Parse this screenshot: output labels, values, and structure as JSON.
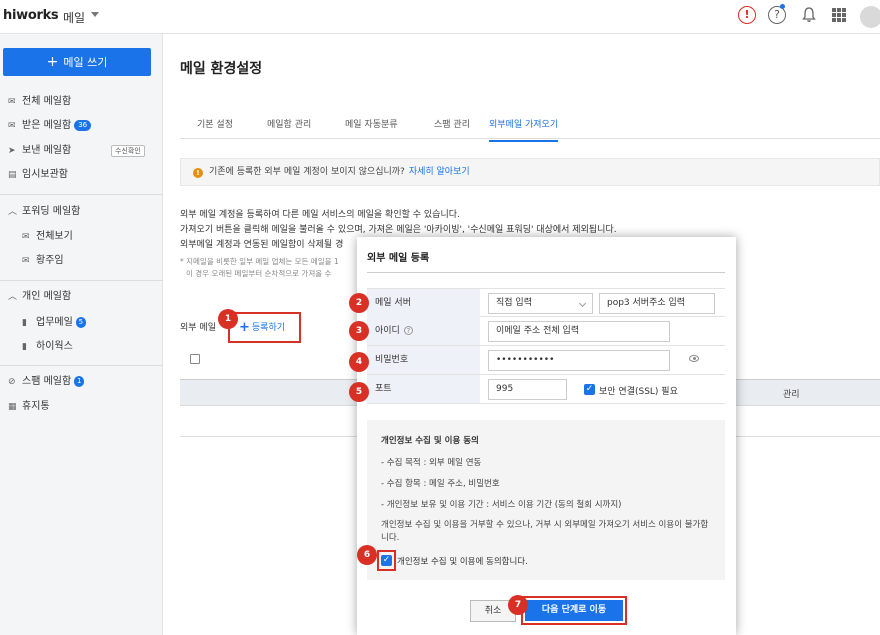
{
  "app": {
    "logo": "hiworks",
    "name": "메일"
  },
  "header_icons": [
    "alert-icon",
    "help-icon",
    "bell-icon",
    "apps-grid-icon",
    "avatar"
  ],
  "sidebar": {
    "write_button": "메일 쓰기",
    "items": [
      {
        "label": "전체 메일함",
        "icon": "mail-icon"
      },
      {
        "label": "받은 메일함",
        "icon": "mail-icon",
        "badge": "36"
      },
      {
        "label": "보낸 메일함",
        "icon": "send-icon",
        "tag": "수신확인"
      },
      {
        "label": "임시보관함",
        "icon": "draft-icon"
      }
    ],
    "forwarding": {
      "label": "포워딩 메일함",
      "children": [
        "전체보기",
        "황주임"
      ]
    },
    "personal": {
      "label": "개인 메일함",
      "children": [
        {
          "label": "업무메일",
          "badge": "5"
        },
        {
          "label": "하이웍스"
        }
      ]
    },
    "spam": {
      "label": "스팸 메일함",
      "badge": "1"
    },
    "trash": {
      "label": "휴지통"
    }
  },
  "main": {
    "title": "메일 환경설정",
    "tabs": [
      "기본 설정",
      "메일함 관리",
      "메일 자동분류",
      "스팸 관리",
      "외부메일 가져오기"
    ],
    "active_tab": "외부메일 가져오기",
    "notice": {
      "text": "기존에 등록한 외부 메일 계정이 보이지 않으십니까?",
      "link": "자세히 알아보기"
    },
    "desc": [
      "외부 메일 계정을 등록하여 다른 메일 서비스의 메일을 확인할 수 있습니다.",
      "가져오기 버튼을 클릭해 메일을 불러올 수 있으며, 가져온 메일은 '아카이빙', '수신메일 표워딩' 대상에서 제외됩니다.",
      "외부메일 계정과 연동된 메일함이 삭제될 경"
    ],
    "notes": [
      "* 지메일을 비롯한 일부 메일 업체는 모든 메일을 1",
      "이 경우 오래된 메일부터 순차적으로 가져올 수"
    ],
    "ext_label": "외부 메일",
    "register_button": "등록하기",
    "table_header_manage": "관리"
  },
  "modal": {
    "title": "외부 메일 등록",
    "fields": {
      "server_label": "메일 서버",
      "server_select": "직접 입력",
      "server_input_placeholder": "pop3 서버주소 입력",
      "id_label": "아이디",
      "id_placeholder": "이메일 주소 전체 입력",
      "pw_label": "비밀번호",
      "pw_value": "•••••••••••",
      "port_label": "포트",
      "port_value": "995",
      "ssl_label": "보안 연결(SSL) 필요",
      "ssl_checked": true
    },
    "privacy": {
      "title": "개인정보 수집 및 이용 동의",
      "lines": [
        "- 수집 목적 : 외부 메일 연동",
        "- 수집 항목 : 메일 주소, 비밀번호",
        "- 개인정보 보유 및 이용 기간 : 서비스 이용 기간 (동의 철회 시까지)"
      ],
      "warning": "개인정보 수집 및 이용을 거부할 수 있으나, 거부 시 외부메일 가져오기 서비스 이용이 불가합니다.",
      "agree_label": "개인정보 수집 및 이용에 동의합니다.",
      "agree_checked": true
    },
    "cancel_button": "취소",
    "next_button": "다음 단계로 이동"
  },
  "step_markers": [
    "1",
    "2",
    "3",
    "4",
    "5",
    "6",
    "7"
  ],
  "colors": {
    "accent": "#1a73e8",
    "highlight": "#d93025",
    "sidebar_bg": "#f4f5f7"
  }
}
